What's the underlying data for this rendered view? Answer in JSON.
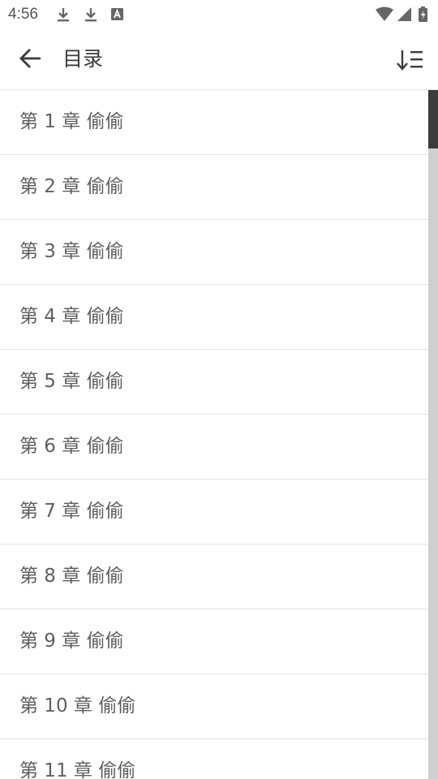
{
  "status_bar": {
    "time": "4:56",
    "left_icons": [
      "download-icon",
      "download-icon",
      "font-a-icon"
    ],
    "right_icons": [
      "wifi-icon",
      "cell-signal-icon",
      "battery-charging-icon"
    ]
  },
  "app_bar": {
    "back_icon": "arrow-left-icon",
    "title": "目录",
    "sort_icon": "sort-descending-icon"
  },
  "chapters": [
    {
      "label": "第 1 章 偷偷"
    },
    {
      "label": "第 2 章 偷偷"
    },
    {
      "label": "第 3 章 偷偷"
    },
    {
      "label": "第 4 章 偷偷"
    },
    {
      "label": "第 5 章 偷偷"
    },
    {
      "label": "第 6 章 偷偷"
    },
    {
      "label": "第 7 章 偷偷"
    },
    {
      "label": "第 8 章 偷偷"
    },
    {
      "label": "第 9 章 偷偷"
    },
    {
      "label": "第 10 章 偷偷"
    },
    {
      "label": "第 11 章 偷偷"
    }
  ],
  "colors": {
    "text": "#5f5f5f",
    "title": "#3a3a3a",
    "divider": "#e4e4e4",
    "scrollbar_track": "#cfcfcf",
    "scrollbar_thumb": "#3c3c3c"
  }
}
